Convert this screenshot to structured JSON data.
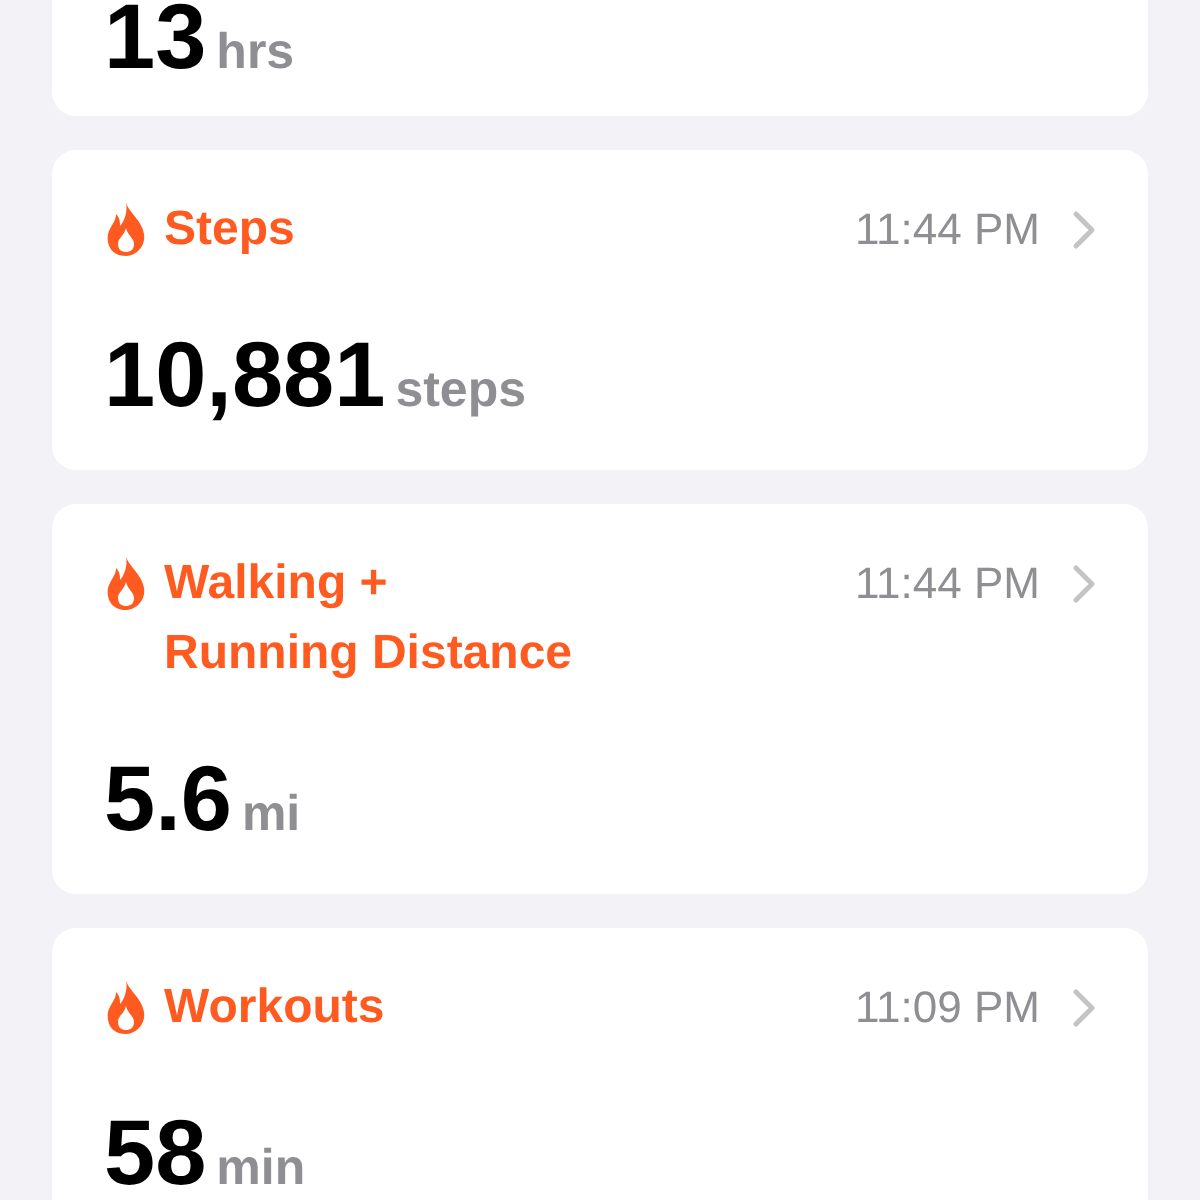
{
  "cards": [
    {
      "value": "13",
      "unit": "hrs"
    },
    {
      "title": "Steps",
      "time": "11:44 PM",
      "value": "10,881",
      "unit": "steps"
    },
    {
      "title": "Walking + Running Distance",
      "time": "11:44 PM",
      "value": "5.6",
      "unit": "mi"
    },
    {
      "title": "Workouts",
      "time": "11:09 PM",
      "value": "58",
      "unit": "min"
    }
  ]
}
